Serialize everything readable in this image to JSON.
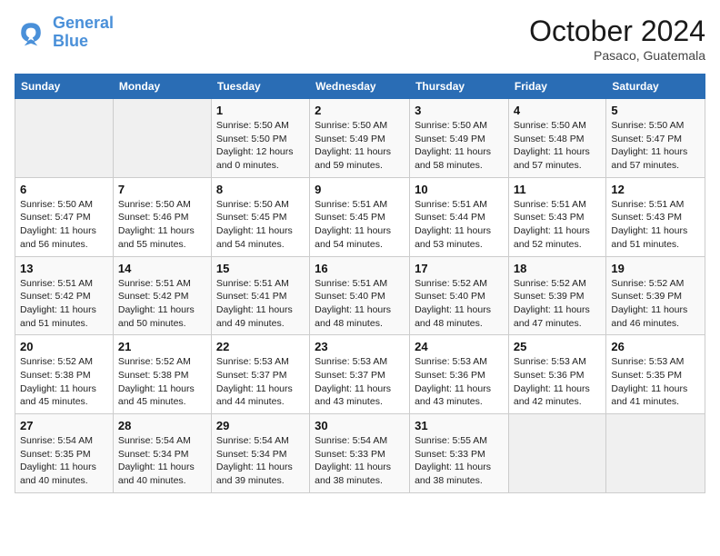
{
  "header": {
    "logo_line1": "General",
    "logo_line2": "Blue",
    "month": "October 2024",
    "location": "Pasaco, Guatemala"
  },
  "days_of_week": [
    "Sunday",
    "Monday",
    "Tuesday",
    "Wednesday",
    "Thursday",
    "Friday",
    "Saturday"
  ],
  "weeks": [
    [
      {
        "day": "",
        "sunrise": "",
        "sunset": "",
        "daylight": ""
      },
      {
        "day": "",
        "sunrise": "",
        "sunset": "",
        "daylight": ""
      },
      {
        "day": "1",
        "sunrise": "Sunrise: 5:50 AM",
        "sunset": "Sunset: 5:50 PM",
        "daylight": "Daylight: 12 hours and 0 minutes."
      },
      {
        "day": "2",
        "sunrise": "Sunrise: 5:50 AM",
        "sunset": "Sunset: 5:49 PM",
        "daylight": "Daylight: 11 hours and 59 minutes."
      },
      {
        "day": "3",
        "sunrise": "Sunrise: 5:50 AM",
        "sunset": "Sunset: 5:49 PM",
        "daylight": "Daylight: 11 hours and 58 minutes."
      },
      {
        "day": "4",
        "sunrise": "Sunrise: 5:50 AM",
        "sunset": "Sunset: 5:48 PM",
        "daylight": "Daylight: 11 hours and 57 minutes."
      },
      {
        "day": "5",
        "sunrise": "Sunrise: 5:50 AM",
        "sunset": "Sunset: 5:47 PM",
        "daylight": "Daylight: 11 hours and 57 minutes."
      }
    ],
    [
      {
        "day": "6",
        "sunrise": "Sunrise: 5:50 AM",
        "sunset": "Sunset: 5:47 PM",
        "daylight": "Daylight: 11 hours and 56 minutes."
      },
      {
        "day": "7",
        "sunrise": "Sunrise: 5:50 AM",
        "sunset": "Sunset: 5:46 PM",
        "daylight": "Daylight: 11 hours and 55 minutes."
      },
      {
        "day": "8",
        "sunrise": "Sunrise: 5:50 AM",
        "sunset": "Sunset: 5:45 PM",
        "daylight": "Daylight: 11 hours and 54 minutes."
      },
      {
        "day": "9",
        "sunrise": "Sunrise: 5:51 AM",
        "sunset": "Sunset: 5:45 PM",
        "daylight": "Daylight: 11 hours and 54 minutes."
      },
      {
        "day": "10",
        "sunrise": "Sunrise: 5:51 AM",
        "sunset": "Sunset: 5:44 PM",
        "daylight": "Daylight: 11 hours and 53 minutes."
      },
      {
        "day": "11",
        "sunrise": "Sunrise: 5:51 AM",
        "sunset": "Sunset: 5:43 PM",
        "daylight": "Daylight: 11 hours and 52 minutes."
      },
      {
        "day": "12",
        "sunrise": "Sunrise: 5:51 AM",
        "sunset": "Sunset: 5:43 PM",
        "daylight": "Daylight: 11 hours and 51 minutes."
      }
    ],
    [
      {
        "day": "13",
        "sunrise": "Sunrise: 5:51 AM",
        "sunset": "Sunset: 5:42 PM",
        "daylight": "Daylight: 11 hours and 51 minutes."
      },
      {
        "day": "14",
        "sunrise": "Sunrise: 5:51 AM",
        "sunset": "Sunset: 5:42 PM",
        "daylight": "Daylight: 11 hours and 50 minutes."
      },
      {
        "day": "15",
        "sunrise": "Sunrise: 5:51 AM",
        "sunset": "Sunset: 5:41 PM",
        "daylight": "Daylight: 11 hours and 49 minutes."
      },
      {
        "day": "16",
        "sunrise": "Sunrise: 5:51 AM",
        "sunset": "Sunset: 5:40 PM",
        "daylight": "Daylight: 11 hours and 48 minutes."
      },
      {
        "day": "17",
        "sunrise": "Sunrise: 5:52 AM",
        "sunset": "Sunset: 5:40 PM",
        "daylight": "Daylight: 11 hours and 48 minutes."
      },
      {
        "day": "18",
        "sunrise": "Sunrise: 5:52 AM",
        "sunset": "Sunset: 5:39 PM",
        "daylight": "Daylight: 11 hours and 47 minutes."
      },
      {
        "day": "19",
        "sunrise": "Sunrise: 5:52 AM",
        "sunset": "Sunset: 5:39 PM",
        "daylight": "Daylight: 11 hours and 46 minutes."
      }
    ],
    [
      {
        "day": "20",
        "sunrise": "Sunrise: 5:52 AM",
        "sunset": "Sunset: 5:38 PM",
        "daylight": "Daylight: 11 hours and 45 minutes."
      },
      {
        "day": "21",
        "sunrise": "Sunrise: 5:52 AM",
        "sunset": "Sunset: 5:38 PM",
        "daylight": "Daylight: 11 hours and 45 minutes."
      },
      {
        "day": "22",
        "sunrise": "Sunrise: 5:53 AM",
        "sunset": "Sunset: 5:37 PM",
        "daylight": "Daylight: 11 hours and 44 minutes."
      },
      {
        "day": "23",
        "sunrise": "Sunrise: 5:53 AM",
        "sunset": "Sunset: 5:37 PM",
        "daylight": "Daylight: 11 hours and 43 minutes."
      },
      {
        "day": "24",
        "sunrise": "Sunrise: 5:53 AM",
        "sunset": "Sunset: 5:36 PM",
        "daylight": "Daylight: 11 hours and 43 minutes."
      },
      {
        "day": "25",
        "sunrise": "Sunrise: 5:53 AM",
        "sunset": "Sunset: 5:36 PM",
        "daylight": "Daylight: 11 hours and 42 minutes."
      },
      {
        "day": "26",
        "sunrise": "Sunrise: 5:53 AM",
        "sunset": "Sunset: 5:35 PM",
        "daylight": "Daylight: 11 hours and 41 minutes."
      }
    ],
    [
      {
        "day": "27",
        "sunrise": "Sunrise: 5:54 AM",
        "sunset": "Sunset: 5:35 PM",
        "daylight": "Daylight: 11 hours and 40 minutes."
      },
      {
        "day": "28",
        "sunrise": "Sunrise: 5:54 AM",
        "sunset": "Sunset: 5:34 PM",
        "daylight": "Daylight: 11 hours and 40 minutes."
      },
      {
        "day": "29",
        "sunrise": "Sunrise: 5:54 AM",
        "sunset": "Sunset: 5:34 PM",
        "daylight": "Daylight: 11 hours and 39 minutes."
      },
      {
        "day": "30",
        "sunrise": "Sunrise: 5:54 AM",
        "sunset": "Sunset: 5:33 PM",
        "daylight": "Daylight: 11 hours and 38 minutes."
      },
      {
        "day": "31",
        "sunrise": "Sunrise: 5:55 AM",
        "sunset": "Sunset: 5:33 PM",
        "daylight": "Daylight: 11 hours and 38 minutes."
      },
      {
        "day": "",
        "sunrise": "",
        "sunset": "",
        "daylight": ""
      },
      {
        "day": "",
        "sunrise": "",
        "sunset": "",
        "daylight": ""
      }
    ]
  ]
}
